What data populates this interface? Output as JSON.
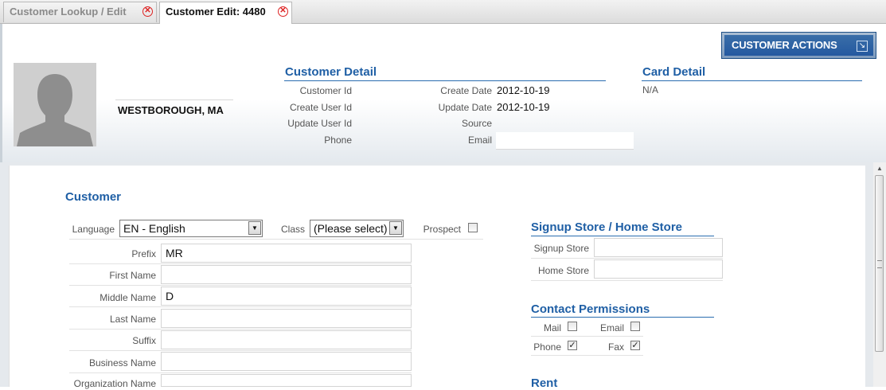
{
  "tabs": [
    {
      "label": "Customer Lookup / Edit",
      "active": false
    },
    {
      "label": "Customer Edit: 4480",
      "active": true
    }
  ],
  "header": {
    "actions_label": "CUSTOMER ACTIONS",
    "location": "WESTBOROUGH, MA"
  },
  "customer_detail": {
    "title": "Customer Detail",
    "labels": {
      "customer_id": "Customer Id",
      "create_user_id": "Create User Id",
      "update_user_id": "Update User Id",
      "phone": "Phone",
      "create_date": "Create Date",
      "update_date": "Update Date",
      "source": "Source",
      "email": "Email"
    },
    "values": {
      "create_date": "2012-10-19",
      "update_date": "2012-10-19"
    }
  },
  "card_detail": {
    "title": "Card Detail",
    "value": "N/A"
  },
  "customer_form": {
    "title": "Customer",
    "language_label": "Language",
    "language_value": "EN - English",
    "class_label": "Class",
    "class_value": "(Please select)",
    "prospect_label": "Prospect",
    "fields": [
      {
        "label": "Prefix",
        "value": "MR"
      },
      {
        "label": "First Name",
        "value": ""
      },
      {
        "label": "Middle Name",
        "value": "D"
      },
      {
        "label": "Last Name",
        "value": ""
      },
      {
        "label": "Suffix",
        "value": ""
      },
      {
        "label": "Business Name",
        "value": ""
      },
      {
        "label": "Organization Name",
        "value": ""
      }
    ]
  },
  "signup_store": {
    "title": "Signup Store / Home Store",
    "signup_label": "Signup Store",
    "home_label": "Home Store"
  },
  "contact_permissions": {
    "title": "Contact Permissions",
    "mail_label": "Mail",
    "email_label": "Email",
    "phone_label": "Phone",
    "fax_label": "Fax",
    "mail_checked": false,
    "email_checked": false,
    "phone_checked": true,
    "fax_checked": true
  },
  "rent": {
    "title": "Rent"
  },
  "colors": {
    "accent": "#1f5fa5",
    "button": "#2459a0",
    "close": "#dd2222"
  }
}
